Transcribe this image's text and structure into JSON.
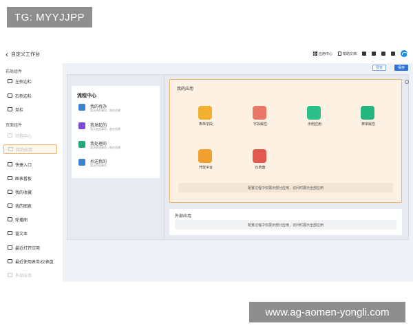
{
  "overlay_label": "TG: MYYJJPP",
  "watermark": "www.ag-aomen-yongli.com",
  "header": {
    "title": "自定义工作台",
    "items": [
      "应用中心",
      "帮助文档"
    ]
  },
  "sidebar": {
    "layout_title": "布局组件",
    "layout_items": [
      "左侧边栏",
      "右侧边栏",
      "单栏"
    ],
    "page_title": "页面组件",
    "page_items": [
      "流程中心",
      "我的应用",
      "快捷入口",
      "图表看板",
      "我的收藏",
      "我的图表",
      "轮播图",
      "富文本",
      "最近打开应用",
      "最近使用表单/仪表盘",
      "外部应用"
    ]
  },
  "toolbar": {
    "preview": "预览",
    "save": "保存"
  },
  "flow_center": {
    "title": "流程中心",
    "items": [
      {
        "label": "我的待办",
        "sub": "暂无待办事项，前往创建",
        "color": "#3b82d0"
      },
      {
        "label": "我发起的",
        "sub": "暂无发起事项，前往创建",
        "color": "#7b4bd6"
      },
      {
        "label": "我处理的",
        "sub": "暂无处理事项，前往创建",
        "color": "#22a77a"
      },
      {
        "label": "抄送我的",
        "sub": "暂无抄送事项",
        "color": "#3b82d0"
      }
    ]
  },
  "my_apps": {
    "title": "我的应用",
    "apps": [
      {
        "label": "表单字段",
        "color": "#f0b030"
      },
      {
        "label": "字段属性",
        "color": "#e9776a"
      },
      {
        "label": "示例应用",
        "color": "#2bbf8a"
      },
      {
        "label": "表单属性",
        "color": "#25b57f"
      },
      {
        "label": "开放平台",
        "color": "#f0a030"
      },
      {
        "label": "仪表盘",
        "color": "#e25a4f"
      }
    ],
    "hint": "配置过程中仅展示部分应用，访问时展示全部应用"
  },
  "external_apps": {
    "title": "外部应用",
    "hint": "配置过程中仅展示部分应用，访问时展示全部应用"
  }
}
